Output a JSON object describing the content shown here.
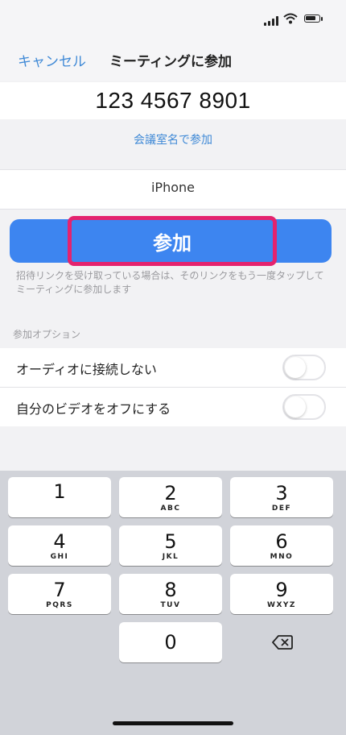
{
  "nav": {
    "cancel_label": "キャンセル",
    "title": "ミーティングに参加"
  },
  "meeting_id": "123 4567 8901",
  "room_name_link": "会議室名で参加",
  "name_field": "iPhone",
  "join_button": "参加",
  "hint": "招待リンクを受け取っている場合は、そのリンクをもう一度タップしてミーティングに参加します",
  "options": {
    "header": "参加オプション",
    "items": [
      {
        "label": "オーディオに接続しない",
        "enabled": false
      },
      {
        "label": "自分のビデオをオフにする",
        "enabled": false
      }
    ]
  },
  "keypad": [
    {
      "digit": "1",
      "letters": ""
    },
    {
      "digit": "2",
      "letters": "ABC"
    },
    {
      "digit": "3",
      "letters": "DEF"
    },
    {
      "digit": "4",
      "letters": "GHI"
    },
    {
      "digit": "5",
      "letters": "JKL"
    },
    {
      "digit": "6",
      "letters": "MNO"
    },
    {
      "digit": "7",
      "letters": "PQRS"
    },
    {
      "digit": "8",
      "letters": "TUV"
    },
    {
      "digit": "9",
      "letters": "WXYZ"
    },
    {
      "digit": "0",
      "letters": ""
    }
  ],
  "colors": {
    "accent": "#3f89d6",
    "join_button": "#3d85f0",
    "highlight": "#e4236e"
  }
}
